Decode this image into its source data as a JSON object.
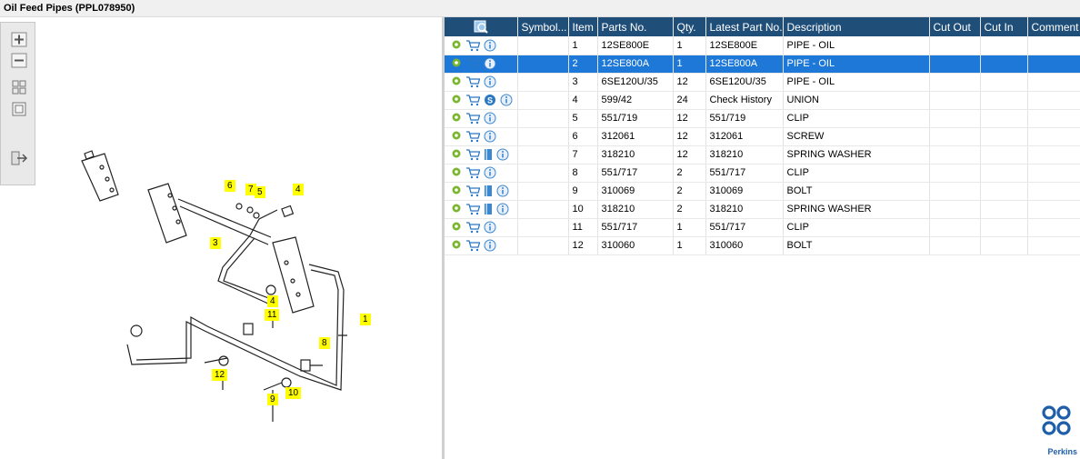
{
  "window": {
    "title": "Oil Feed Pipes (PPL078950)"
  },
  "toolbar": {
    "buttons": [
      "zoom-in",
      "zoom-out",
      "fit-page",
      "actual-size",
      "export"
    ]
  },
  "grid": {
    "columns": [
      "",
      "Symbol...",
      "Item",
      "Parts No.",
      "Qty.",
      "Latest Part No.",
      "Description",
      "Cut Out",
      "Cut In",
      "Comment"
    ],
    "rows": [
      {
        "item": "1",
        "parts_no": "12SE800E",
        "qty": "1",
        "latest": "12SE800E",
        "desc": "PIPE - OIL",
        "extra": "info"
      },
      {
        "item": "2",
        "parts_no": "12SE800A",
        "qty": "1",
        "latest": "12SE800A",
        "desc": "PIPE - OIL",
        "extra": "info",
        "selected": true
      },
      {
        "item": "3",
        "parts_no": "6SE120U/35",
        "qty": "12",
        "latest": "6SE120U/35",
        "desc": "PIPE - OIL",
        "extra": "info"
      },
      {
        "item": "4",
        "parts_no": "599/42",
        "qty": "24",
        "latest": "Check History",
        "desc": "UNION",
        "extra": "s-info"
      },
      {
        "item": "5",
        "parts_no": "551/719",
        "qty": "12",
        "latest": "551/719",
        "desc": "CLIP",
        "extra": "info"
      },
      {
        "item": "6",
        "parts_no": "312061",
        "qty": "12",
        "latest": "312061",
        "desc": "SCREW",
        "extra": "info"
      },
      {
        "item": "7",
        "parts_no": "318210",
        "qty": "12",
        "latest": "318210",
        "desc": "SPRING WASHER",
        "extra": "book-info"
      },
      {
        "item": "8",
        "parts_no": "551/717",
        "qty": "2",
        "latest": "551/717",
        "desc": "CLIP",
        "extra": "info"
      },
      {
        "item": "9",
        "parts_no": "310069",
        "qty": "2",
        "latest": "310069",
        "desc": "BOLT",
        "extra": "book-info"
      },
      {
        "item": "10",
        "parts_no": "318210",
        "qty": "2",
        "latest": "318210",
        "desc": "SPRING WASHER",
        "extra": "book-info"
      },
      {
        "item": "11",
        "parts_no": "551/717",
        "qty": "1",
        "latest": "551/717",
        "desc": "CLIP",
        "extra": "info"
      },
      {
        "item": "12",
        "parts_no": "310060",
        "qty": "1",
        "latest": "310060",
        "desc": "BOLT",
        "extra": "info"
      }
    ]
  },
  "diagram": {
    "callouts": [
      "1",
      "3",
      "4",
      "4",
      "5",
      "6",
      "7",
      "8",
      "9",
      "10",
      "11",
      "12"
    ]
  },
  "brand": {
    "name": "Perkins",
    "color": "#1f5fa9"
  },
  "colors": {
    "header": "#1f4e79",
    "selected": "#1e78d8",
    "callout": "#ffff00"
  }
}
